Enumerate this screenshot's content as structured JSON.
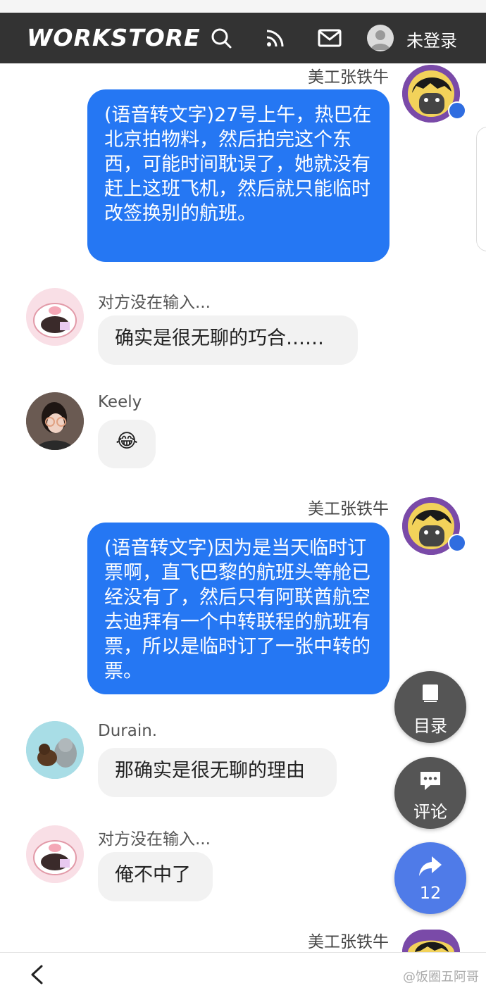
{
  "header": {
    "logo": "WORKSTORE",
    "login_label": "未登录",
    "icons": [
      "search-icon",
      "rss-icon",
      "mail-icon",
      "user-avatar"
    ]
  },
  "messages": [
    {
      "sender": "美工张铁牛",
      "text": "(语音转文字)27号上午，热巴在北京拍物料，然后拍完这个东西，可能时间耽误了，她就没有赶上这班飞机，然后就只能临时改签换别的航班。"
    },
    {
      "sender": "对方没在输入...",
      "text": "确实是很无聊的巧合……"
    },
    {
      "sender": "Keely",
      "text": "😂"
    },
    {
      "sender": "美工张铁牛",
      "text": "(语音转文字)因为是当天临时订票啊，直飞巴黎的航班头等舱已经没有了，然后只有阿联酋航空去迪拜有一个中转联程的航班有票，所以是临时订了一张中转的票。"
    },
    {
      "sender": "Durain.",
      "text": "那确实是很无聊的理由"
    },
    {
      "sender": "对方没在输入...",
      "text": "俺不中了"
    },
    {
      "sender": "美工张铁牛"
    }
  ],
  "fabs": {
    "toc_label": "目录",
    "comment_label": "评论",
    "share_count": "12"
  },
  "footer": {
    "watermark": "@饭圈五阿哥"
  },
  "colors": {
    "accent_blue": "#2577f3",
    "header_bg": "#333333",
    "fab_dark": "#555555",
    "fab_share": "#4f7be8"
  }
}
